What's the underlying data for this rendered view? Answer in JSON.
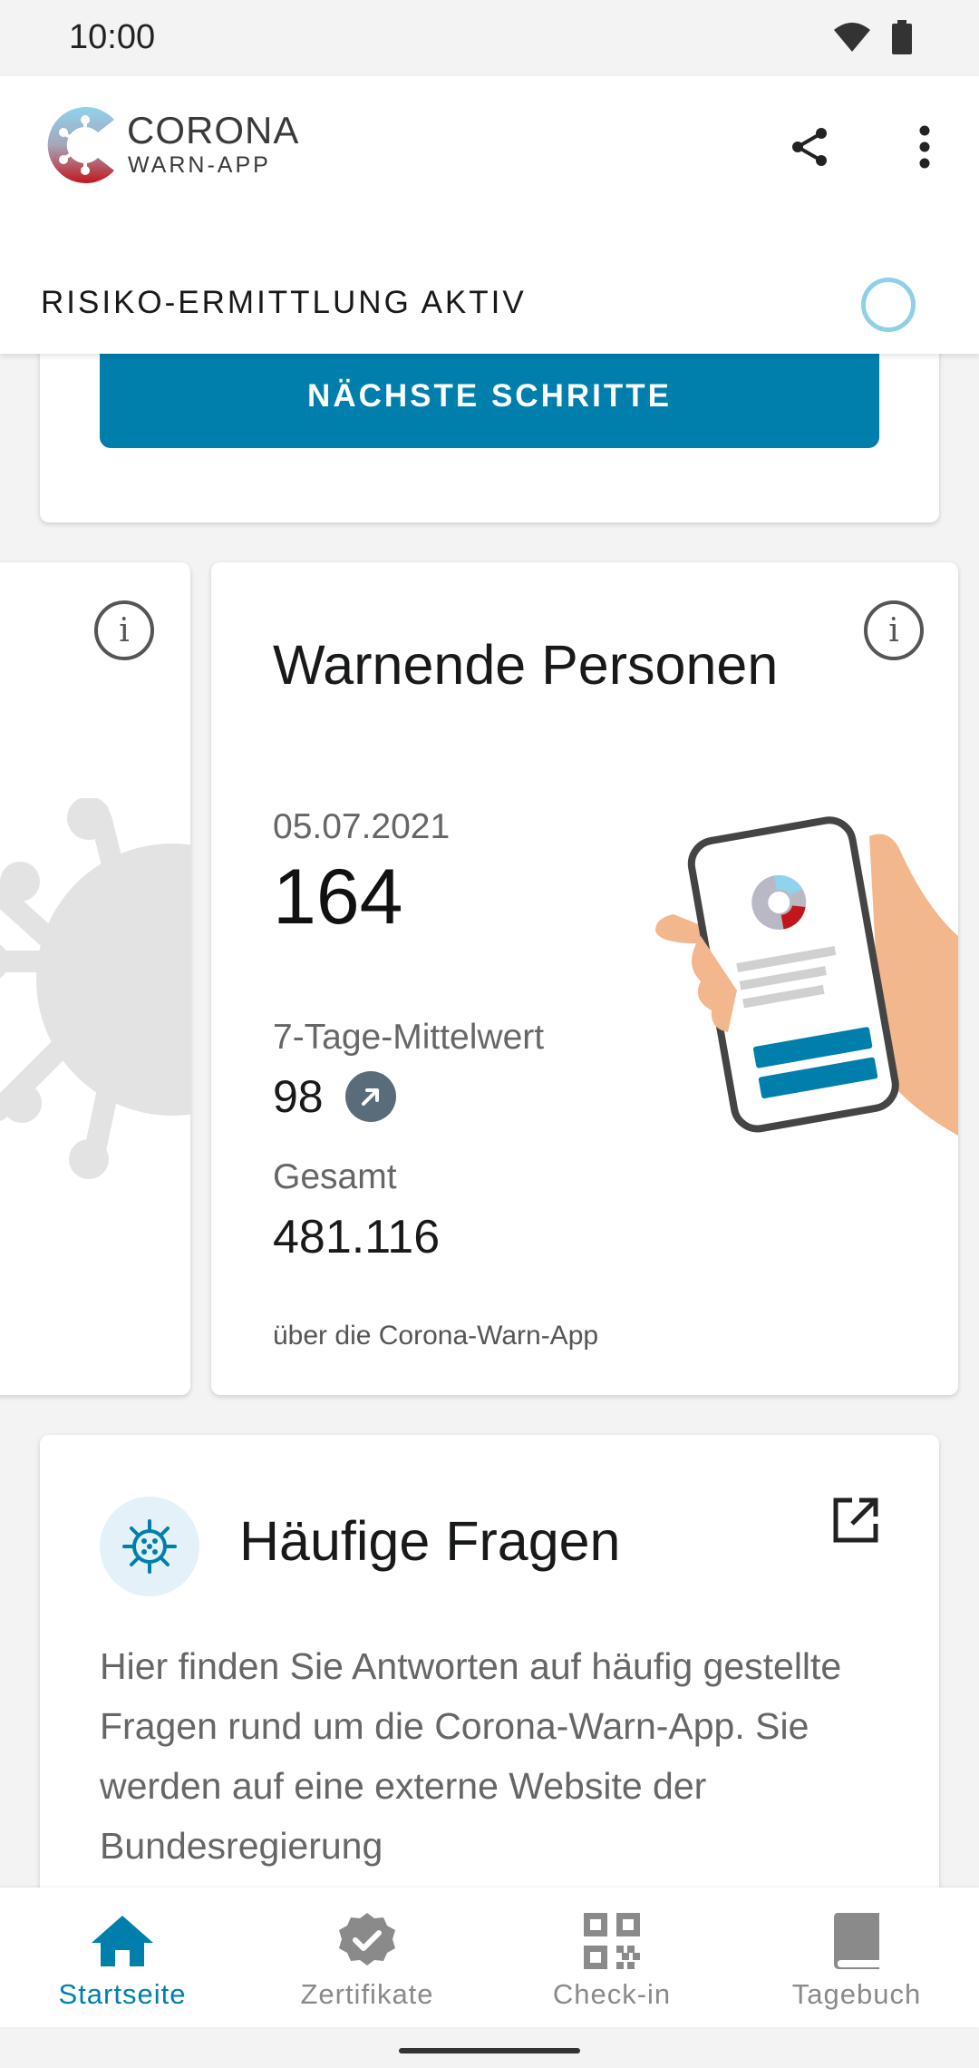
{
  "status_bar": {
    "time": "10:00",
    "icons": [
      "wifi-icon",
      "battery-icon"
    ]
  },
  "app_bar": {
    "logo_title": "CORONA",
    "logo_subtitle": "WARN-APP",
    "actions": [
      "share-icon",
      "more-vert-icon"
    ]
  },
  "risk": {
    "status_label": "RISIKO-ERMITTLUNG AKTIV",
    "next_steps_button": "NÄCHSTE SCHRITTE"
  },
  "statistics": {
    "title": "Warnende Personen",
    "date": "05.07.2021",
    "value": "164",
    "avg_label": "7-Tage-Mittelwert",
    "avg_value": "98",
    "avg_trend": "increasing",
    "total_label": "Gesamt",
    "total_value": "481.116",
    "source": "über die Corona-Warn-App"
  },
  "faq": {
    "title": "Häufige Fragen",
    "text": "Hier finden Sie Antworten auf häufig gestellte Fragen rund um die Corona-Warn-App. Sie werden auf eine externe Website der Bundesregierung"
  },
  "bottom_nav": {
    "items": [
      {
        "label": "Startseite",
        "icon": "home-icon",
        "active": true
      },
      {
        "label": "Zertifikate",
        "icon": "certificate-icon",
        "active": false
      },
      {
        "label": "Check-in",
        "icon": "qr-code-icon",
        "active": false
      },
      {
        "label": "Tagebuch",
        "icon": "book-icon",
        "active": false
      }
    ]
  },
  "colors": {
    "primary": "#007fad",
    "background": "#f3f3f3",
    "risk_indicator": "#8fd0e6",
    "trend_badge": "#5a6b7a"
  }
}
